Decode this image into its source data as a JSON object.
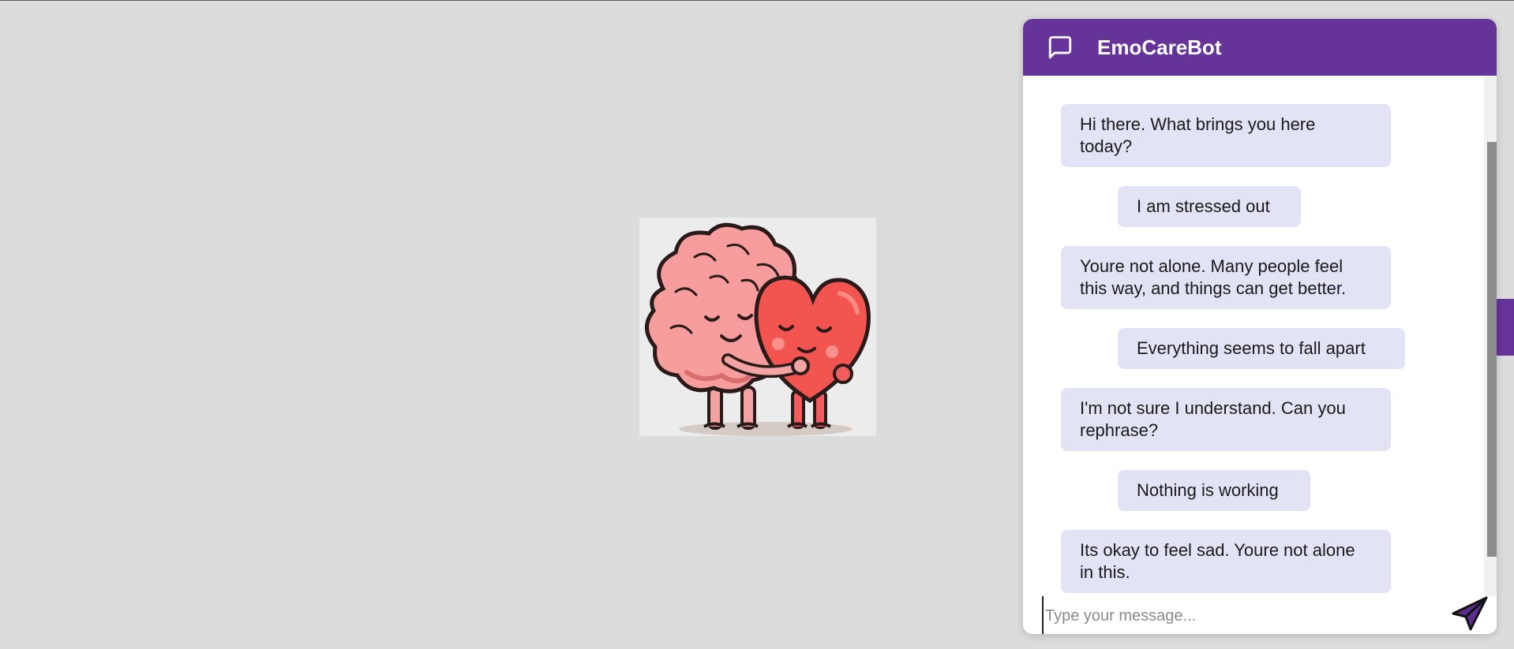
{
  "colors": {
    "accent": "#663399",
    "page_background": "#dcdcdc",
    "bubble": "#e3e3f6"
  },
  "chat": {
    "title": "EmoCareBot",
    "header_icon": "message-square-icon",
    "messages": [
      {
        "from": "bot",
        "text": "Hi there. What brings you here today?"
      },
      {
        "from": "user",
        "text": "I am stressed out"
      },
      {
        "from": "bot",
        "text": "Youre not alone. Many people feel this way, and things can get better."
      },
      {
        "from": "user",
        "text": "Everything seems to fall apart"
      },
      {
        "from": "bot",
        "text": "I'm not sure I understand. Can you rephrase?"
      },
      {
        "from": "user",
        "text": "Nothing is working"
      },
      {
        "from": "bot",
        "text": "Its okay to feel sad. Youre not alone in this."
      }
    ],
    "input": {
      "value": "",
      "placeholder": "Type your message..."
    },
    "send_icon": "send-icon"
  },
  "illustration": {
    "subject": "brain-hugging-heart"
  }
}
